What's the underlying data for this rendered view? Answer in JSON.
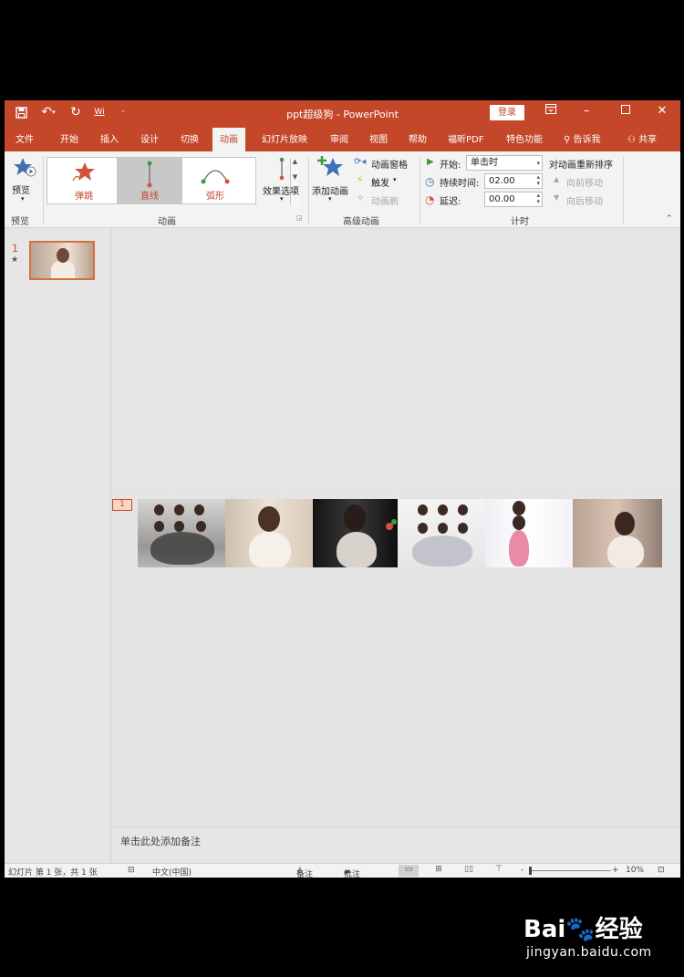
{
  "window": {
    "title": "ppt超级狗 - PowerPoint",
    "login_label": "登录",
    "qat_version_label": "Wi"
  },
  "tabs": [
    "文件",
    "开始",
    "插入",
    "设计",
    "切换",
    "动画",
    "幻灯片放映",
    "审阅",
    "视图",
    "帮助",
    "福昕PDF",
    "特色功能"
  ],
  "active_tab": "动画",
  "tell_me": "告诉我",
  "share": "共享",
  "ribbon": {
    "preview": {
      "button": "预览",
      "group": "预览"
    },
    "animation": {
      "items": [
        "弹跳",
        "直线",
        "弧形"
      ],
      "selected": "直线",
      "effect_options": "效果选项",
      "group": "动画"
    },
    "advanced": {
      "add_animation": "添加动画",
      "animation_pane": "动画窗格",
      "trigger": "触发",
      "painter": "动画刷",
      "group": "高级动画"
    },
    "timing": {
      "start_label": "开始:",
      "start_value": "单击时",
      "duration_label": "持续时间:",
      "duration_value": "02.00",
      "delay_label": "延迟:",
      "delay_value": "00.00",
      "reorder": "对动画重新排序",
      "move_earlier": "向前移动",
      "move_later": "向后移动",
      "group": "计时"
    }
  },
  "slides": [
    {
      "number": "1",
      "star": "★"
    }
  ],
  "canvas": {
    "animation_badge": "1"
  },
  "notes_placeholder": "单击此处添加备注",
  "status": {
    "slide_info": "幻灯片 第 1 张，共 1 张",
    "language": "中文(中国)",
    "notes": "备注",
    "comments": "批注",
    "zoom_minus": "-",
    "zoom_plus": "+",
    "zoom": "10%"
  },
  "watermark": {
    "logo": "Bai",
    "logo_tail": "经验",
    "url": "jingyan.baidu.com"
  },
  "colors": {
    "accent": "#c4472a",
    "ribbon_bg": "#f3f3f3",
    "canvas_bg": "#e6e6e6"
  }
}
